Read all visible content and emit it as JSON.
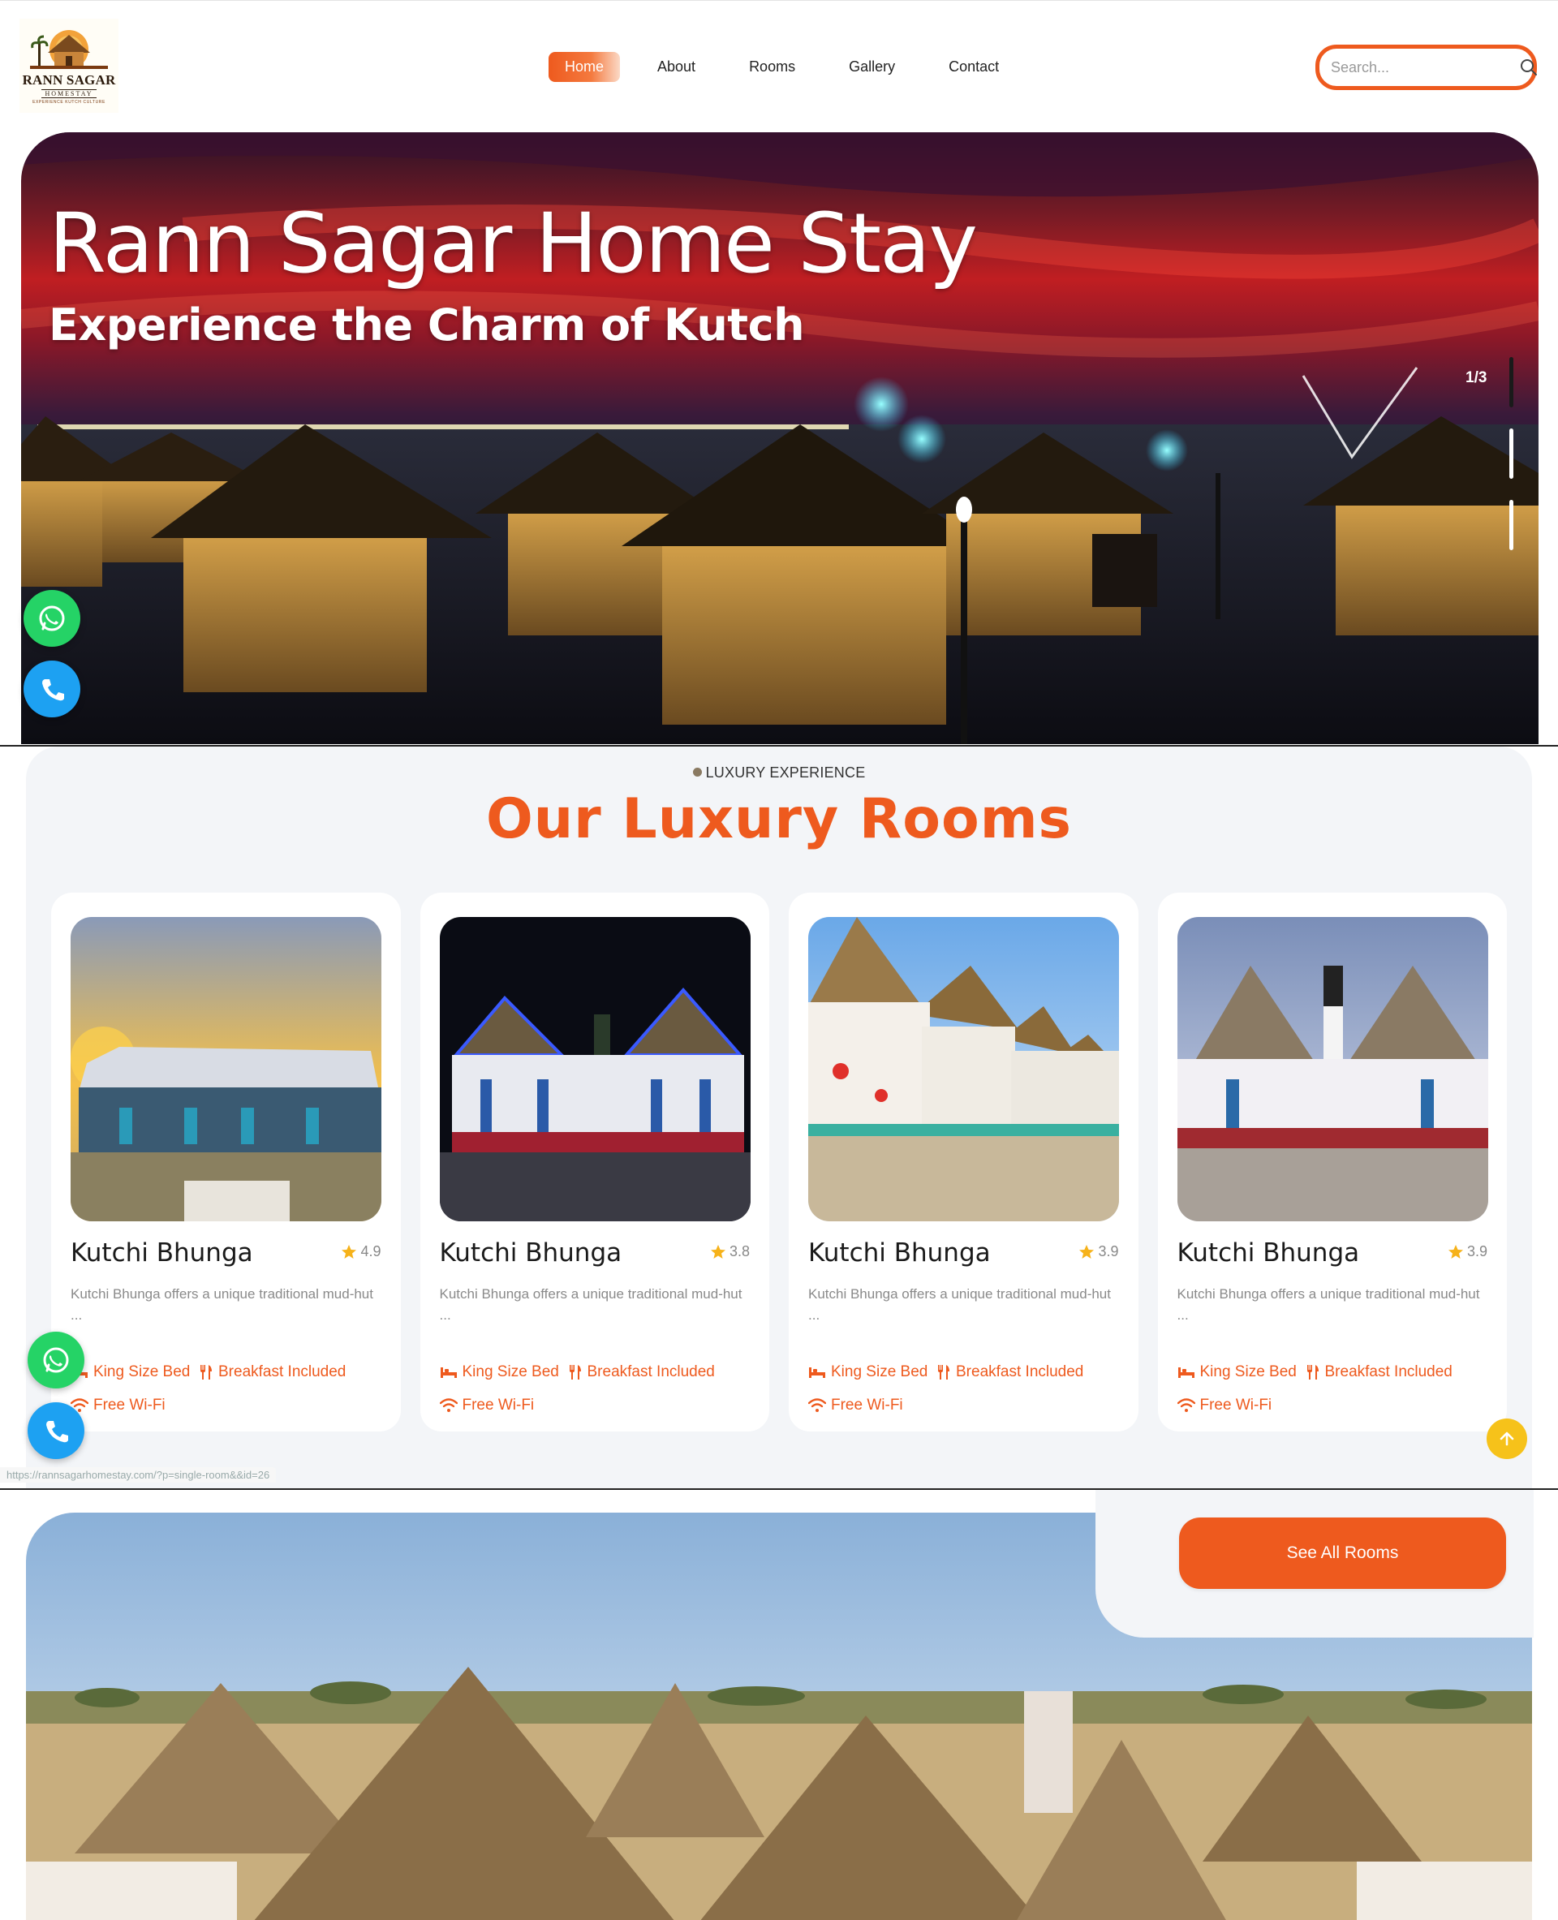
{
  "brand": {
    "logo_title": "RANN SAGAR",
    "logo_sub": "HOMESTAY",
    "logo_tag": "EXPERIENCE KUTCH CULTURE"
  },
  "nav": {
    "items": [
      {
        "label": "Home",
        "active": true
      },
      {
        "label": "About",
        "active": false
      },
      {
        "label": "Rooms",
        "active": false
      },
      {
        "label": "Gallery",
        "active": false
      },
      {
        "label": "Contact",
        "active": false
      }
    ]
  },
  "search": {
    "placeholder": "Search...",
    "icon": "search-icon"
  },
  "hero": {
    "title": "Rann Sagar Home Stay",
    "subtitle": "Experience the Charm of Kutch",
    "slide_counter": "1/3",
    "current_slide": 1,
    "total_slides": 3
  },
  "contact_buttons": {
    "whatsapp_icon": "whatsapp-icon",
    "phone_icon": "phone-icon"
  },
  "rooms": {
    "eyebrow": "LUXURY EXPERIENCE",
    "title": "Our Luxury Rooms",
    "cards": [
      {
        "name": "Kutchi Bhunga",
        "rating": "4.9",
        "description": "Kutchi Bhunga offers a unique traditional mud-hut ...",
        "features": {
          "bed": "King Size Bed",
          "breakfast": "Breakfast Included",
          "wifi": "Free Wi-Fi"
        }
      },
      {
        "name": "Kutchi Bhunga",
        "rating": "3.8",
        "description": "Kutchi Bhunga offers a unique traditional mud-hut ...",
        "features": {
          "bed": "King Size Bed",
          "breakfast": "Breakfast Included",
          "wifi": "Free Wi-Fi"
        }
      },
      {
        "name": "Kutchi Bhunga",
        "rating": "3.9",
        "description": "Kutchi Bhunga offers a unique traditional mud-hut ...",
        "features": {
          "bed": "King Size Bed",
          "breakfast": "Breakfast Included",
          "wifi": "Free Wi-Fi"
        }
      },
      {
        "name": "Kutchi Bhunga",
        "rating": "3.9",
        "description": "Kutchi Bhunga offers a unique traditional mud-hut ...",
        "features": {
          "bed": "King Size Bed",
          "breakfast": "Breakfast Included",
          "wifi": "Free Wi-Fi"
        }
      }
    ],
    "see_all_label": "See All Rooms"
  },
  "status_url": "https://rannsagarhomestay.com/?p=single-room&&id=26",
  "colors": {
    "accent": "#ee5a1e",
    "whatsapp": "#25d366",
    "phone": "#1da1f2",
    "scroll_top": "#f6c21a",
    "star": "#f6b21a"
  }
}
